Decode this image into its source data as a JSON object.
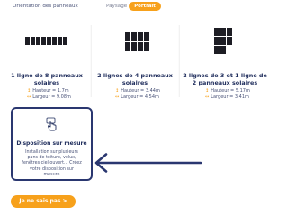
{
  "orientation": {
    "label": "Orientation des panneaux",
    "options": [
      "Paysage",
      "Portrait"
    ],
    "selected": "Portrait"
  },
  "cards": [
    {
      "title": "1 ligne de 8 panneaux solaires",
      "height": "Hauteur = 1.7m",
      "width": "Largeur = 9.08m"
    },
    {
      "title": "2 lignes de 4 panneaux solaires",
      "height": "Hauteur = 3.44m",
      "width": "Largeur = 4.54m"
    },
    {
      "title": "2 lignes de 3 et 1 ligne de 2 panneaux solaires",
      "height": "Hauteur = 5.17m",
      "width": "Largeur = 3.41m"
    }
  ],
  "custom": {
    "title": "Disposition sur mesure",
    "description": "Installation sur plusieurs pans de toiture, velux, fenêtres ciel ouvert... Créez votre disposition sur mesure"
  },
  "dunno_button": "Je ne sais pas  >",
  "colors": {
    "accent": "#f7a11b",
    "navy": "#1f2d5c",
    "panel": "#1d1d24",
    "arrow": "#2a3770"
  },
  "icons": {
    "height": "arrows-vertical-icon",
    "width": "arrows-horizontal-icon",
    "custom": "hand-pointer-icon"
  }
}
